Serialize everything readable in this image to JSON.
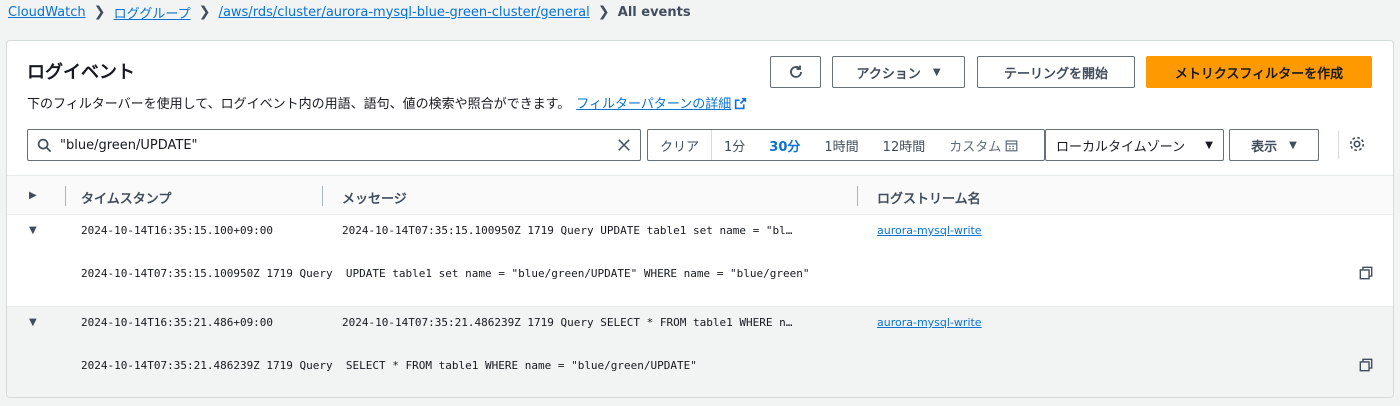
{
  "breadcrumb": {
    "items": [
      "CloudWatch",
      "ロググループ",
      "/aws/rds/cluster/aurora-mysql-blue-green-cluster/general"
    ],
    "current": "All events"
  },
  "header": {
    "title": "ログイベント",
    "description": "下のフィルターバーを使用して、ログイベント内の用語、語句、値の検索や照合ができます。",
    "link": "フィルターパターンの詳細"
  },
  "toolbar": {
    "actions_label": "アクション",
    "tail_label": "テーリングを開始",
    "primary_label": "メトリクスフィルターを作成"
  },
  "search": {
    "value": "\"blue/green/UPDATE\""
  },
  "timerange": {
    "clear": "クリア",
    "options": [
      "1分",
      "30分",
      "1時間",
      "12時間"
    ],
    "active": "30分",
    "custom": "カスタム"
  },
  "timezone": {
    "value": "ローカルタイムゾーン"
  },
  "display": {
    "label": "表示"
  },
  "table": {
    "columns": [
      "タイムスタンプ",
      "メッセージ",
      "ログストリーム名"
    ],
    "rows": [
      {
        "timestamp": "2024-10-14T16:35:15.100+09:00",
        "message": "2024-10-14T07:35:15.100950Z 1719 Query UPDATE table1 set name = \"bl…",
        "stream": "aurora-mysql-write",
        "full": "2024-10-14T07:35:15.100950Z 1719 Query  UPDATE table1 set name = \"blue/green/UPDATE\" WHERE name = \"blue/green\""
      },
      {
        "timestamp": "2024-10-14T16:35:21.486+09:00",
        "message": "2024-10-14T07:35:21.486239Z 1719 Query SELECT * FROM table1 WHERE n…",
        "stream": "aurora-mysql-write",
        "full": "2024-10-14T07:35:21.486239Z 1719 Query  SELECT * FROM table1 WHERE name = \"blue/green/UPDATE\""
      }
    ]
  },
  "colors": {
    "link": "#0972d3",
    "primary": "#ff9900"
  }
}
